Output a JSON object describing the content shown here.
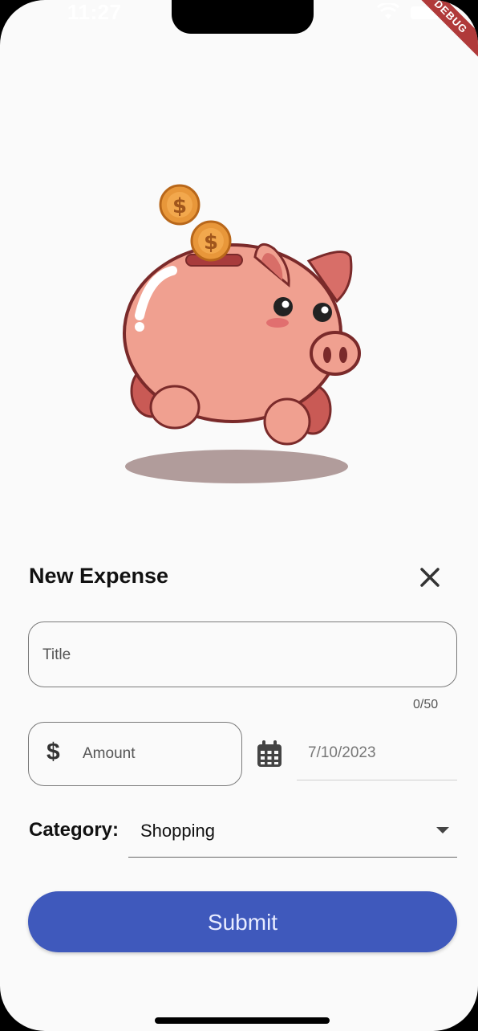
{
  "status_bar": {
    "time": "11:27",
    "debug_label": "DEBUG"
  },
  "sheet": {
    "title": "New Expense",
    "title_field": {
      "placeholder": "Title",
      "counter": "0/50"
    },
    "amount_field": {
      "prefix_icon": "dollar-icon",
      "placeholder": "Amount"
    },
    "date": {
      "icon": "calendar-icon",
      "value": "7/10/2023"
    },
    "category": {
      "label": "Category:",
      "selected": "Shopping"
    },
    "submit_label": "Submit"
  },
  "colors": {
    "primary": "#3f59bc",
    "background": "#fafafa",
    "pig_body": "#f0a090",
    "coin": "#e8973a"
  }
}
